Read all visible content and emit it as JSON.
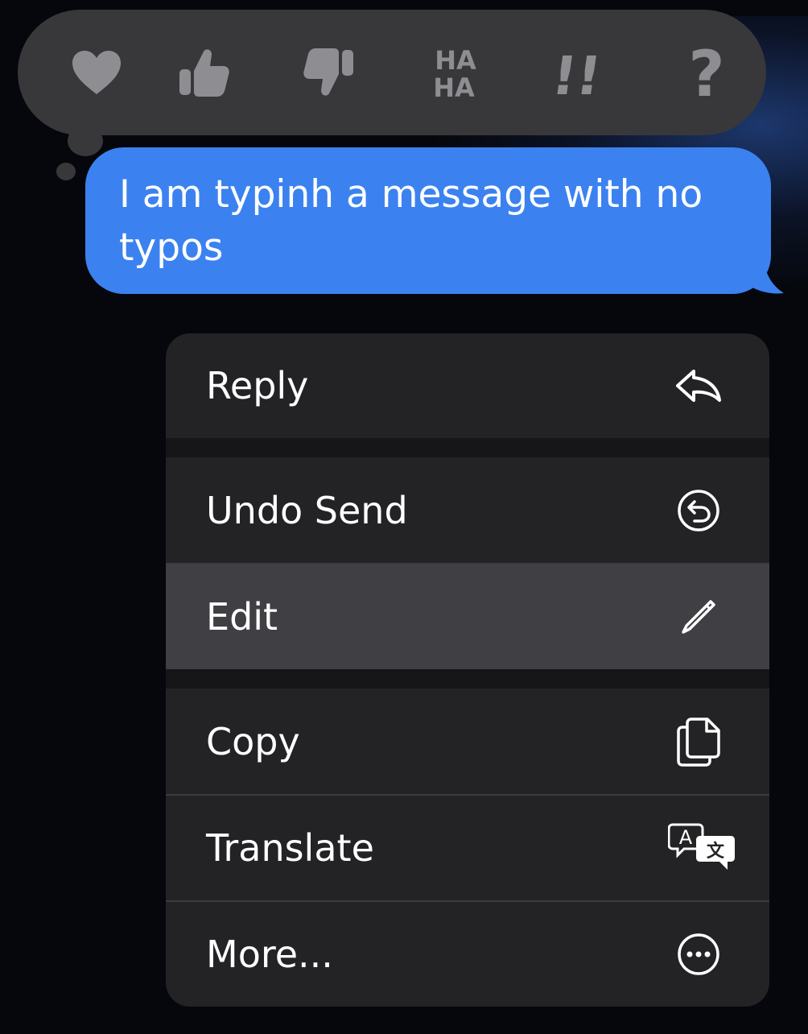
{
  "tapbacks": [
    {
      "name": "heart"
    },
    {
      "name": "thumbs-up"
    },
    {
      "name": "thumbs-down"
    },
    {
      "name": "haha",
      "line1": "HA",
      "line2": "HA"
    },
    {
      "name": "exclamation",
      "glyph": "!!"
    },
    {
      "name": "question",
      "glyph": "?"
    }
  ],
  "message": {
    "text": "I am typinh a message with no typos"
  },
  "menu": {
    "items": [
      {
        "label": "Reply",
        "icon": "reply-icon"
      },
      {
        "label": "Undo Send",
        "icon": "undo-send-icon"
      },
      {
        "label": "Edit",
        "icon": "pencil-icon",
        "highlighted": true
      },
      {
        "label": "Copy",
        "icon": "copy-icon"
      },
      {
        "label": "Translate",
        "icon": "translate-icon",
        "icon_text_a": "A",
        "icon_text_b": "文"
      },
      {
        "label": "More...",
        "icon": "ellipsis-circle-icon"
      }
    ]
  },
  "colors": {
    "background": "#06070c",
    "tapback_bar": "#38383b",
    "tapback_icon": "#8e8e92",
    "bubble": "#3b82f0",
    "menu": "#232325",
    "menu_highlight": "#403f43"
  }
}
